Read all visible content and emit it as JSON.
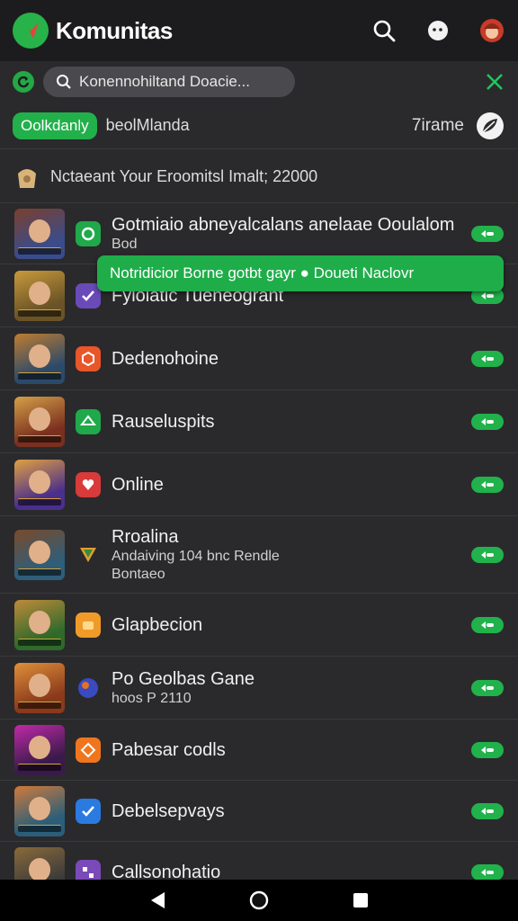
{
  "app": {
    "title": "Komunitas"
  },
  "search": {
    "query": "Konennohiltand  Doacie..."
  },
  "filter": {
    "chip": "Oolkdanly",
    "label": "beolMlanda",
    "right_label": "7irame"
  },
  "notice": {
    "text": "Nctaeant Your Eroomitsl Imalt; 22000"
  },
  "popup": {
    "text": "Notridicior Borne gotbt gayr ● Doueti Naclovr"
  },
  "rows": [
    {
      "title": "Gotmiaio abneyalcalans anelaae Ooulalom",
      "sub": "Bod",
      "sub2": "",
      "icon": "ring-icon",
      "icon_color": "#1fa94a",
      "thumb_bg": "#3a4c8a",
      "thumb_accent": "#7b3f2e"
    },
    {
      "title": "Fylolatic Tueneogrant",
      "sub": "",
      "sub2": "",
      "icon": "check-icon",
      "icon_color": "#6a4ab8",
      "thumb_bg": "#6a5326",
      "thumb_accent": "#c89a3c"
    },
    {
      "title": "Dedenohoine",
      "sub": "",
      "sub2": "",
      "icon": "hex-icon",
      "icon_color": "#e8562a",
      "thumb_bg": "#2b4a6a",
      "thumb_accent": "#c07c30"
    },
    {
      "title": "Rauseluspits",
      "sub": "",
      "sub2": "",
      "icon": "controller-icon",
      "icon_color": "#1fa94a",
      "thumb_bg": "#7a2f1f",
      "thumb_accent": "#d4a048"
    },
    {
      "title": "Online",
      "sub": "",
      "sub2": "",
      "icon": "heart-icon",
      "icon_color": "#d93a3a",
      "thumb_bg": "#4b2f8c",
      "thumb_accent": "#e0a040"
    },
    {
      "title": "Rroalina",
      "sub": "Andaiving 104 bnc Rendle",
      "sub2": "Bontaeo",
      "icon": "shield-icon",
      "icon_color": "transparent",
      "thumb_bg": "#2e5e7a",
      "thumb_accent": "#7a4a2a"
    },
    {
      "title": "Glapbecion",
      "sub": "",
      "sub2": "",
      "icon": "folder-icon",
      "icon_color": "#f09a2a",
      "thumb_bg": "#2f6a2a",
      "thumb_accent": "#c08a3a"
    },
    {
      "title": "Po Geolbas Gane",
      "sub": "hoos Р 2110",
      "sub2": "",
      "icon": "orb-icon",
      "icon_color": "transparent",
      "thumb_bg": "#8a3a1a",
      "thumb_accent": "#e0903a"
    },
    {
      "title": "Pabesar codls",
      "sub": "",
      "sub2": "",
      "icon": "diamond-icon",
      "icon_color": "#f0761e",
      "thumb_bg": "#3a1a4a",
      "thumb_accent": "#c02aa8"
    },
    {
      "title": "Debelsepvays",
      "sub": "",
      "sub2": "",
      "icon": "check-icon",
      "icon_color": "#2a7ae0",
      "thumb_bg": "#2a5e7a",
      "thumb_accent": "#d07a3a"
    },
    {
      "title": "Callsonohatio",
      "sub": "",
      "sub2": "",
      "icon": "grid-icon",
      "icon_color": "#7a4ab8",
      "thumb_bg": "#3a3a3a",
      "thumb_accent": "#8a6a3a"
    }
  ]
}
